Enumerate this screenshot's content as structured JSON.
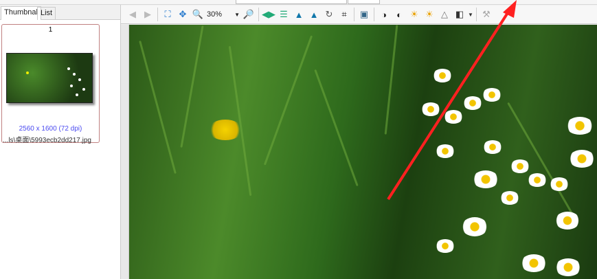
{
  "tabs": [
    {
      "label": "Thumbnal"
    },
    {
      "label": "List"
    }
  ],
  "thumbnail": {
    "index": "1",
    "dimensions": "2560 x 1600 (72 dpi)",
    "filename": "...ls\\桌面\\5993ecb2dd217.jpg"
  },
  "toolbar": {
    "zoom_value": "30%",
    "icons": [
      "previous-icon",
      "next-icon",
      "fit-window-icon",
      "actual-size-icon",
      "zoom-in-icon",
      "zoom-out-icon",
      "flip-horizontal-icon",
      "flip-vertical-icon",
      "rotate-left-icon",
      "rotate-right-icon",
      "rotate-free-icon",
      "crop-icon",
      "refresh-image-icon",
      "contrast-up-icon",
      "contrast-down-icon",
      "brightness-up-icon",
      "brightness-down-icon",
      "sharpen-icon",
      "compare-icon",
      "tools-icon"
    ]
  },
  "colors": {
    "accent": "#4a4af0",
    "arrow": "#ff2020"
  }
}
